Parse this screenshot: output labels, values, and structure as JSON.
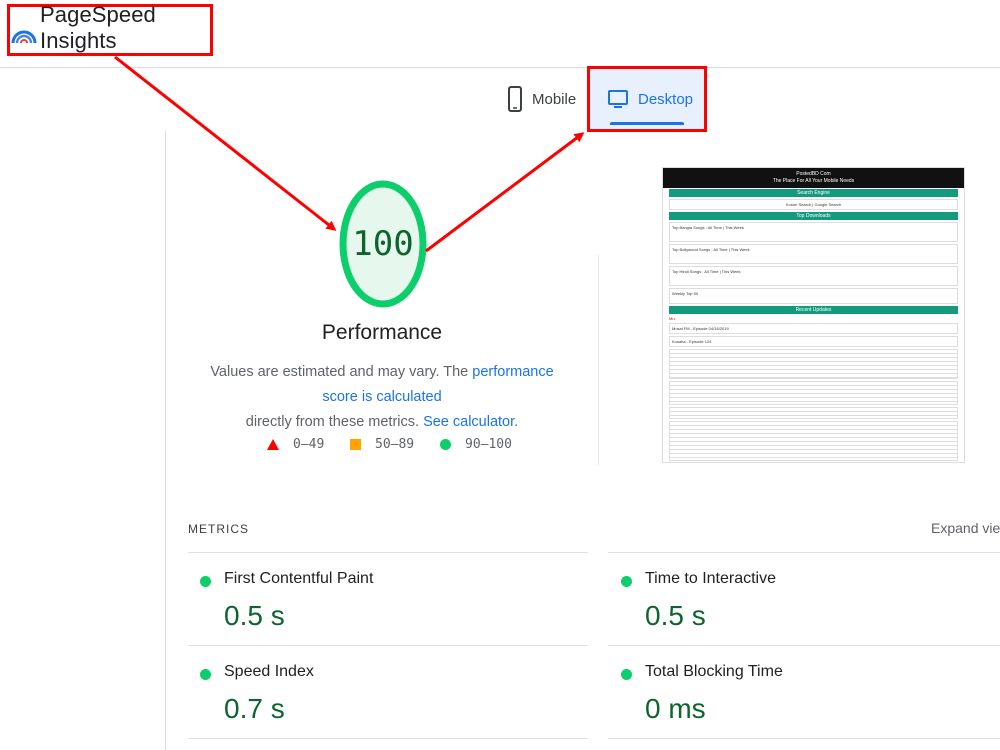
{
  "header": {
    "title": "PageSpeed Insights",
    "logo_icon": "pagespeed-logo-icon"
  },
  "tabs": [
    {
      "label": "Mobile",
      "icon": "phone-icon",
      "selected": false
    },
    {
      "label": "Desktop",
      "icon": "monitor-icon",
      "selected": true
    }
  ],
  "score": {
    "value": "100",
    "title": "Performance",
    "desc_part1": "Values are estimated and may vary. The ",
    "desc_link1": "performance score is calculated",
    "desc_part2": "directly from these metrics. ",
    "desc_link2": "See calculator."
  },
  "legend": [
    {
      "range": "0–49",
      "icon": "triangle-icon",
      "color": "#ff0000"
    },
    {
      "range": "50–89",
      "icon": "square-icon",
      "color": "#ffa400"
    },
    {
      "range": "90–100",
      "icon": "circle-icon",
      "color": "#0cce6b"
    }
  ],
  "screenshot": {
    "site_title": "PostedBD Com",
    "site_tagline": "The Place For All Your Mobile Needs",
    "bars": [
      "Search Engine",
      "Top Downloads",
      "Recent Updates"
    ],
    "search_line": "Kolorn Search | Google Search",
    "rows": [
      "Top Bangla Songs : All Time | This Week",
      "Top Bollywood Songs : All Time | This Week",
      "Top Hindi Songs : All Time | This Week",
      "Weekly Top 50"
    ],
    "news_label": "Mu:",
    "updates": [
      "Mosal FM - Episode 04/16/2019",
      "Kusaha - Episode 124"
    ]
  },
  "metrics": {
    "label": "METRICS",
    "expand": "Expand view",
    "items": [
      {
        "name": "First Contentful Paint",
        "value": "0.5 s"
      },
      {
        "name": "Time to Interactive",
        "value": "0.5 s"
      },
      {
        "name": "Speed Index",
        "value": "0.7 s"
      },
      {
        "name": "Total Blocking Time",
        "value": "0 ms"
      }
    ]
  },
  "colors": {
    "accent": "#1a73e8",
    "pass": "#0cce6b",
    "pass_text": "#0d652d",
    "annotation": "#ff0000"
  }
}
